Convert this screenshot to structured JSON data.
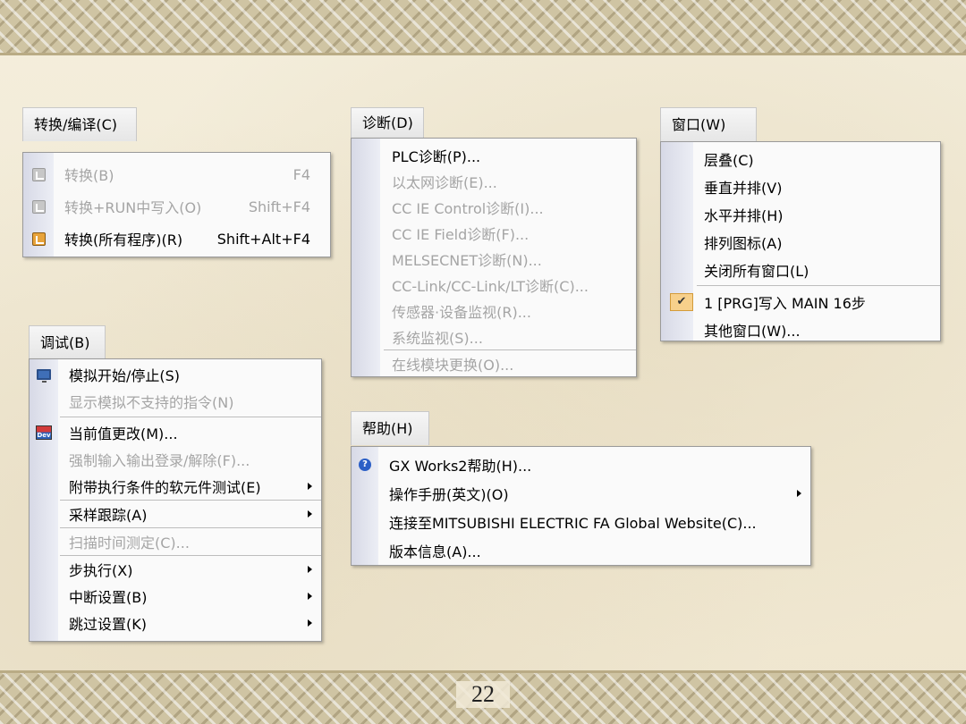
{
  "slide": {
    "page_number": "22"
  },
  "menus": {
    "convert": {
      "title": "转换/编译(C)",
      "items": [
        {
          "label": "转换(B)",
          "shortcut": "F4",
          "disabled": true,
          "icon": "convert-icon"
        },
        {
          "label": "转换+RUN中写入(O)",
          "shortcut": "Shift+F4",
          "disabled": true,
          "icon": "convert-run-write-icon"
        },
        {
          "label": "转换(所有程序)(R)",
          "shortcut": "Shift+Alt+F4",
          "disabled": false,
          "icon": "convert-all-icon"
        }
      ]
    },
    "diagnose": {
      "title": "诊断(D)",
      "items": [
        {
          "label": "PLC诊断(P)...",
          "disabled": false
        },
        {
          "label": "以太网诊断(E)...",
          "disabled": true
        },
        {
          "label": "CC IE Control诊断(I)...",
          "disabled": true
        },
        {
          "label": "CC IE Field诊断(F)...",
          "disabled": true
        },
        {
          "label": "MELSECNET诊断(N)...",
          "disabled": true
        },
        {
          "label": "CC-Link/CC-Link/LT诊断(C)...",
          "disabled": true
        },
        {
          "label": "传感器·设备监视(R)...",
          "disabled": true
        },
        {
          "label": "系统监视(S)...",
          "disabled": true
        },
        {
          "label": "在线模块更换(O)...",
          "disabled": true
        }
      ]
    },
    "window": {
      "title": "窗口(W)",
      "items": [
        {
          "label": "层叠(C)"
        },
        {
          "label": "垂直并排(V)"
        },
        {
          "label": "水平并排(H)"
        },
        {
          "label": "排列图标(A)"
        },
        {
          "label": "关闭所有窗口(L)"
        },
        {
          "label": "1 [PRG]写入 MAIN 16步",
          "checked": true,
          "check_glyph": "✔"
        },
        {
          "label": "其他窗口(W)..."
        }
      ]
    },
    "debug": {
      "title": "调试(B)",
      "items": [
        {
          "label": "模拟开始/停止(S)",
          "disabled": false,
          "icon": "simulation-icon"
        },
        {
          "label": "显示模拟不支持的指令(N)",
          "disabled": true
        },
        {
          "label": "当前值更改(M)...",
          "disabled": false,
          "icon": "dev-icon",
          "icon_text": "Dev"
        },
        {
          "label": "强制输入输出登录/解除(F)...",
          "disabled": true
        },
        {
          "label": "附带执行条件的软元件测试(E)",
          "disabled": false,
          "submenu": true
        },
        {
          "label": "采样跟踪(A)",
          "disabled": false,
          "submenu": true
        },
        {
          "label": "扫描时间测定(C)...",
          "disabled": true
        },
        {
          "label": "步执行(X)",
          "disabled": false,
          "submenu": true
        },
        {
          "label": "中断设置(B)",
          "disabled": false,
          "submenu": true
        },
        {
          "label": "跳过设置(K)",
          "disabled": false,
          "submenu": true
        }
      ]
    },
    "help": {
      "title": "帮助(H)",
      "items": [
        {
          "label": "GX Works2帮助(H)...",
          "icon": "help-icon",
          "icon_text": "?"
        },
        {
          "label": "操作手册(英文)(O)",
          "submenu": true
        },
        {
          "label": "连接至MITSUBISHI ELECTRIC FA Global Website(C)..."
        },
        {
          "label": "版本信息(A)..."
        }
      ]
    }
  }
}
